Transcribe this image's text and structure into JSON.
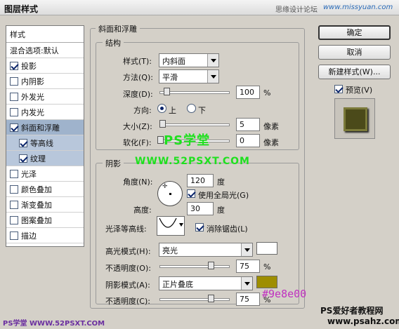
{
  "window": {
    "title": "图层样式",
    "watermark_cn": "思缘设计论坛",
    "watermark_en": "www.missyuan.com"
  },
  "left_panel": {
    "header": "样式",
    "items": [
      {
        "label": "混合选项:默认",
        "checkbox": false
      },
      {
        "label": "投影",
        "checkbox": true,
        "checked": true
      },
      {
        "label": "内阴影",
        "checkbox": true,
        "checked": false
      },
      {
        "label": "外发光",
        "checkbox": true,
        "checked": false
      },
      {
        "label": "内发光",
        "checkbox": true,
        "checked": false
      },
      {
        "label": "斜面和浮雕",
        "checkbox": true,
        "checked": true,
        "selected": true
      },
      {
        "label": "等高线",
        "checkbox": true,
        "checked": true,
        "sub": true
      },
      {
        "label": "纹理",
        "checkbox": true,
        "checked": true,
        "sub": true
      },
      {
        "label": "光泽",
        "checkbox": true,
        "checked": false
      },
      {
        "label": "颜色叠加",
        "checkbox": true,
        "checked": false
      },
      {
        "label": "渐变叠加",
        "checkbox": true,
        "checked": false
      },
      {
        "label": "图案叠加",
        "checkbox": true,
        "checked": false
      },
      {
        "label": "描边",
        "checkbox": true,
        "checked": false
      }
    ]
  },
  "bevel": {
    "title": "斜面和浮雕",
    "structure": {
      "title": "结构",
      "style_label": "样式(T):",
      "style_value": "内斜面",
      "technique_label": "方法(Q):",
      "technique_value": "平滑",
      "depth_label": "深度(D):",
      "depth_value": "100",
      "depth_unit": "%",
      "depth_level_pct": 10,
      "direction_label": "方向:",
      "dir_up": "上",
      "dir_down": "下",
      "direction_selected": "上",
      "size_label": "大小(Z):",
      "size_value": "5",
      "size_unit": "像素",
      "soften_label": "软化(F):",
      "soften_value": "0",
      "soften_unit": "像素"
    },
    "shading": {
      "title": "阴影",
      "angle_label": "角度(N):",
      "angle_value": "120",
      "angle_unit": "度",
      "global_light_label": "使用全局光(G)",
      "global_light_checked": true,
      "altitude_label": "高度:",
      "altitude_value": "30",
      "altitude_unit": "度",
      "gloss_label": "光泽等高线:",
      "antialias_label": "消除锯齿(L)",
      "antialias_checked": true,
      "highlight_mode_label": "高光模式(H):",
      "highlight_mode_value": "亮光",
      "highlight_opacity_label": "不透明度(O):",
      "highlight_opacity_value": "75",
      "highlight_opacity_unit": "%",
      "shadow_mode_label": "阴影模式(A):",
      "shadow_mode_value": "正片叠底",
      "shadow_opacity_label": "不透明度(C):",
      "shadow_opacity_value": "75",
      "shadow_opacity_unit": "%",
      "highlight_color": "#ffffff",
      "shadow_color": "#9e8e00",
      "shadow_color_text": "#9e8e00"
    }
  },
  "buttons": {
    "ok": "确定",
    "cancel": "取消",
    "new_style": "新建样式(W)...",
    "preview": "预览(V)",
    "preview_checked": true
  },
  "watermarks": {
    "ps_xuetang": "PS学堂",
    "site": "WWW.52PSXT.COM",
    "bottom_left": "PS学堂 WWW.52PSXT.COM",
    "bottom_right_cn": "PS爱好者教程网",
    "bottom_right_en": "www.psahz.com"
  }
}
